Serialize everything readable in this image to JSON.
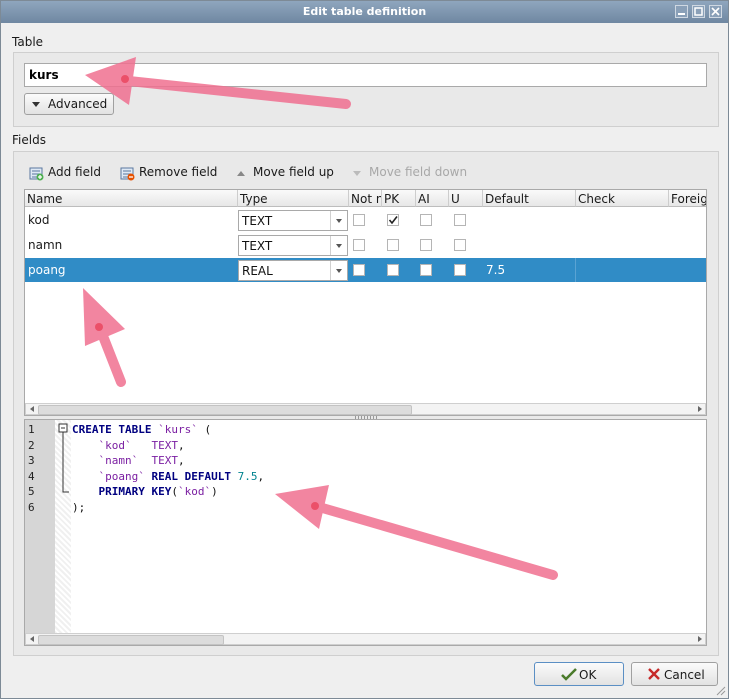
{
  "window": {
    "title": "Edit table definition"
  },
  "table_section": {
    "label": "Table",
    "name_value": "kurs",
    "advanced_label": "Advanced"
  },
  "fields_section": {
    "label": "Fields",
    "toolbar": {
      "add": "Add field",
      "remove": "Remove field",
      "up": "Move field up",
      "down": "Move field down"
    },
    "columns": [
      "Name",
      "Type",
      "Not n",
      "PK",
      "AI",
      "U",
      "Default",
      "Check",
      "Foreign"
    ],
    "rows": [
      {
        "name": "kod",
        "type": "TEXT",
        "not_null": false,
        "pk": true,
        "ai": false,
        "u": false,
        "default": ""
      },
      {
        "name": "namn",
        "type": "TEXT",
        "not_null": false,
        "pk": false,
        "ai": false,
        "u": false,
        "default": ""
      },
      {
        "name": "poang",
        "type": "REAL",
        "not_null": false,
        "pk": false,
        "ai": false,
        "u": false,
        "default": "7.5",
        "selected": true
      }
    ]
  },
  "sql": {
    "line_numbers": [
      "1",
      "2",
      "3",
      "4",
      "5",
      "6"
    ],
    "lines": [
      {
        "t": [
          [
            "kw",
            "CREATE TABLE"
          ],
          [
            "pl",
            " "
          ],
          [
            "id",
            "`kurs`"
          ],
          [
            "pl",
            " ("
          ]
        ]
      },
      {
        "t": [
          [
            "pl",
            "    "
          ],
          [
            "id",
            "`kod`"
          ],
          [
            "pl",
            "   "
          ],
          [
            "id",
            "TEXT"
          ],
          [
            "pl",
            ","
          ]
        ]
      },
      {
        "t": [
          [
            "pl",
            "    "
          ],
          [
            "id",
            "`namn`"
          ],
          [
            "pl",
            "  "
          ],
          [
            "id",
            "TEXT"
          ],
          [
            "pl",
            ","
          ]
        ]
      },
      {
        "t": [
          [
            "pl",
            "    "
          ],
          [
            "id",
            "`poang`"
          ],
          [
            "pl",
            " "
          ],
          [
            "kw",
            "REAL DEFAULT"
          ],
          [
            "pl",
            " "
          ],
          [
            "num",
            "7.5"
          ],
          [
            "pl",
            ","
          ]
        ]
      },
      {
        "t": [
          [
            "pl",
            "    "
          ],
          [
            "kw",
            "PRIMARY KEY"
          ],
          [
            "pl",
            "("
          ],
          [
            "id",
            "`kod`"
          ],
          [
            "pl",
            ")"
          ]
        ]
      },
      {
        "t": [
          [
            "pl",
            ");"
          ]
        ]
      }
    ]
  },
  "buttons": {
    "ok": "OK",
    "cancel": "Cancel"
  },
  "colors": {
    "selection": "#308cc6",
    "arrow": "#f07090",
    "titlebar": "#7f96b0"
  }
}
